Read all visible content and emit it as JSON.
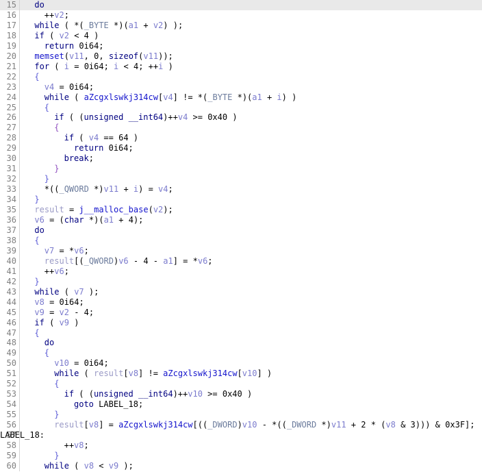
{
  "app": {
    "name": "hex-rays-decompiler-pseudocode",
    "view": "pseudocode",
    "first_line": 15,
    "last_line": 60,
    "highlighted_line": 15,
    "colors": {
      "background": "#ffffff",
      "current_line_highlight": "#e9e9e9",
      "gutter_text": "#808080",
      "gutter_separator": "#d4d4d4",
      "keyword": "#000080",
      "type": "#6b7b9c",
      "local_variable": "#7b7bcd",
      "global_name": "#1414cc",
      "result_variable": "#9a9ac6",
      "punctuation": "#000000",
      "brace_blue": "#5c5cd6",
      "brace_purple": "#8f4fbf"
    }
  },
  "lines": [
    {
      "n": "15",
      "indent": 2,
      "tokens": [
        {
          "t": "do",
          "c": "kw"
        }
      ]
    },
    {
      "n": "16",
      "indent": 4,
      "tokens": [
        {
          "t": "++",
          "c": "pun"
        },
        {
          "t": "v2",
          "c": "loc"
        },
        {
          "t": ";",
          "c": "pun"
        }
      ]
    },
    {
      "n": "17",
      "indent": 2,
      "tokens": [
        {
          "t": "while",
          "c": "kw"
        },
        {
          "t": " ( *(",
          "c": "pun"
        },
        {
          "t": "_BYTE",
          "c": "typ"
        },
        {
          "t": " *)(",
          "c": "pun"
        },
        {
          "t": "a1",
          "c": "loc"
        },
        {
          "t": " + ",
          "c": "pun"
        },
        {
          "t": "v2",
          "c": "loc"
        },
        {
          "t": ") );",
          "c": "pun"
        }
      ]
    },
    {
      "n": "18",
      "indent": 2,
      "tokens": [
        {
          "t": "if",
          "c": "kw"
        },
        {
          "t": " ( ",
          "c": "pun"
        },
        {
          "t": "v2",
          "c": "loc"
        },
        {
          "t": " < ",
          "c": "pun"
        },
        {
          "t": "4",
          "c": "num"
        },
        {
          "t": " )",
          "c": "pun"
        }
      ]
    },
    {
      "n": "19",
      "indent": 4,
      "tokens": [
        {
          "t": "return",
          "c": "kw"
        },
        {
          "t": " ",
          "c": "pun"
        },
        {
          "t": "0i64",
          "c": "num"
        },
        {
          "t": ";",
          "c": "pun"
        }
      ]
    },
    {
      "n": "20",
      "indent": 2,
      "tokens": [
        {
          "t": "memset",
          "c": "glb"
        },
        {
          "t": "(",
          "c": "pun"
        },
        {
          "t": "v11",
          "c": "loc"
        },
        {
          "t": ", ",
          "c": "pun"
        },
        {
          "t": "0",
          "c": "num"
        },
        {
          "t": ", ",
          "c": "pun"
        },
        {
          "t": "sizeof",
          "c": "kw"
        },
        {
          "t": "(",
          "c": "pun"
        },
        {
          "t": "v11",
          "c": "loc"
        },
        {
          "t": "));",
          "c": "pun"
        }
      ]
    },
    {
      "n": "21",
      "indent": 2,
      "tokens": [
        {
          "t": "for",
          "c": "kw"
        },
        {
          "t": " ( ",
          "c": "pun"
        },
        {
          "t": "i",
          "c": "loc"
        },
        {
          "t": " = ",
          "c": "pun"
        },
        {
          "t": "0i64",
          "c": "num"
        },
        {
          "t": "; ",
          "c": "pun"
        },
        {
          "t": "i",
          "c": "loc"
        },
        {
          "t": " < ",
          "c": "pun"
        },
        {
          "t": "4",
          "c": "num"
        },
        {
          "t": "; ++",
          "c": "pun"
        },
        {
          "t": "i",
          "c": "loc"
        },
        {
          "t": " )",
          "c": "pun"
        }
      ]
    },
    {
      "n": "22",
      "indent": 2,
      "tokens": [
        {
          "t": "{",
          "c": "brc"
        }
      ]
    },
    {
      "n": "23",
      "indent": 4,
      "tokens": [
        {
          "t": "v4",
          "c": "loc"
        },
        {
          "t": " = ",
          "c": "pun"
        },
        {
          "t": "0i64",
          "c": "num"
        },
        {
          "t": ";",
          "c": "pun"
        }
      ]
    },
    {
      "n": "24",
      "indent": 4,
      "tokens": [
        {
          "t": "while",
          "c": "kw"
        },
        {
          "t": " ( ",
          "c": "pun"
        },
        {
          "t": "aZcgxlswkj314cw",
          "c": "glb"
        },
        {
          "t": "[",
          "c": "pun"
        },
        {
          "t": "v4",
          "c": "loc"
        },
        {
          "t": "] != *(",
          "c": "pun"
        },
        {
          "t": "_BYTE",
          "c": "typ"
        },
        {
          "t": " *)(",
          "c": "pun"
        },
        {
          "t": "a1",
          "c": "loc"
        },
        {
          "t": " + ",
          "c": "pun"
        },
        {
          "t": "i",
          "c": "loc"
        },
        {
          "t": ") )",
          "c": "pun"
        }
      ]
    },
    {
      "n": "25",
      "indent": 4,
      "tokens": [
        {
          "t": "{",
          "c": "brc"
        }
      ]
    },
    {
      "n": "26",
      "indent": 6,
      "tokens": [
        {
          "t": "if",
          "c": "kw"
        },
        {
          "t": " ( (",
          "c": "pun"
        },
        {
          "t": "unsigned",
          "c": "kw"
        },
        {
          "t": " ",
          "c": "pun"
        },
        {
          "t": "__int64",
          "c": "kw"
        },
        {
          "t": ")++",
          "c": "pun"
        },
        {
          "t": "v4",
          "c": "loc"
        },
        {
          "t": " >= ",
          "c": "pun"
        },
        {
          "t": "0x40",
          "c": "num"
        },
        {
          "t": " )",
          "c": "pun"
        }
      ]
    },
    {
      "n": "27",
      "indent": 6,
      "tokens": [
        {
          "t": "{",
          "c": "brc2"
        }
      ]
    },
    {
      "n": "28",
      "indent": 8,
      "tokens": [
        {
          "t": "if",
          "c": "kw"
        },
        {
          "t": " ( ",
          "c": "pun"
        },
        {
          "t": "v4",
          "c": "loc"
        },
        {
          "t": " == ",
          "c": "pun"
        },
        {
          "t": "64",
          "c": "num"
        },
        {
          "t": " )",
          "c": "pun"
        }
      ]
    },
    {
      "n": "29",
      "indent": 10,
      "tokens": [
        {
          "t": "return",
          "c": "kw"
        },
        {
          "t": " ",
          "c": "pun"
        },
        {
          "t": "0i64",
          "c": "num"
        },
        {
          "t": ";",
          "c": "pun"
        }
      ]
    },
    {
      "n": "30",
      "indent": 8,
      "tokens": [
        {
          "t": "break",
          "c": "kw"
        },
        {
          "t": ";",
          "c": "pun"
        }
      ]
    },
    {
      "n": "31",
      "indent": 6,
      "tokens": [
        {
          "t": "}",
          "c": "brc2"
        }
      ]
    },
    {
      "n": "32",
      "indent": 4,
      "tokens": [
        {
          "t": "}",
          "c": "brc"
        }
      ]
    },
    {
      "n": "33",
      "indent": 4,
      "tokens": [
        {
          "t": "*((",
          "c": "pun"
        },
        {
          "t": "_QWORD",
          "c": "typ"
        },
        {
          "t": " *)",
          "c": "pun"
        },
        {
          "t": "v11",
          "c": "loc"
        },
        {
          "t": " + ",
          "c": "pun"
        },
        {
          "t": "i",
          "c": "loc"
        },
        {
          "t": ") = ",
          "c": "pun"
        },
        {
          "t": "v4",
          "c": "loc"
        },
        {
          "t": ";",
          "c": "pun"
        }
      ]
    },
    {
      "n": "34",
      "indent": 2,
      "tokens": [
        {
          "t": "}",
          "c": "brc"
        }
      ]
    },
    {
      "n": "35",
      "indent": 2,
      "tokens": [
        {
          "t": "result",
          "c": "res"
        },
        {
          "t": " = ",
          "c": "pun"
        },
        {
          "t": "j__malloc_base",
          "c": "glb"
        },
        {
          "t": "(",
          "c": "pun"
        },
        {
          "t": "v2",
          "c": "loc"
        },
        {
          "t": ");",
          "c": "pun"
        }
      ]
    },
    {
      "n": "36",
      "indent": 2,
      "tokens": [
        {
          "t": "v6",
          "c": "loc"
        },
        {
          "t": " = (",
          "c": "pun"
        },
        {
          "t": "char",
          "c": "kw"
        },
        {
          "t": " *)(",
          "c": "pun"
        },
        {
          "t": "a1",
          "c": "loc"
        },
        {
          "t": " + ",
          "c": "pun"
        },
        {
          "t": "4",
          "c": "num"
        },
        {
          "t": ");",
          "c": "pun"
        }
      ]
    },
    {
      "n": "37",
      "indent": 2,
      "tokens": [
        {
          "t": "do",
          "c": "kw"
        }
      ]
    },
    {
      "n": "38",
      "indent": 2,
      "tokens": [
        {
          "t": "{",
          "c": "brc"
        }
      ]
    },
    {
      "n": "39",
      "indent": 4,
      "tokens": [
        {
          "t": "v7",
          "c": "loc"
        },
        {
          "t": " = *",
          "c": "pun"
        },
        {
          "t": "v6",
          "c": "loc"
        },
        {
          "t": ";",
          "c": "pun"
        }
      ]
    },
    {
      "n": "40",
      "indent": 4,
      "tokens": [
        {
          "t": "result",
          "c": "res"
        },
        {
          "t": "[(",
          "c": "pun"
        },
        {
          "t": "_QWORD",
          "c": "typ"
        },
        {
          "t": ")",
          "c": "pun"
        },
        {
          "t": "v6",
          "c": "loc"
        },
        {
          "t": " - ",
          "c": "pun"
        },
        {
          "t": "4",
          "c": "num"
        },
        {
          "t": " - ",
          "c": "pun"
        },
        {
          "t": "a1",
          "c": "loc"
        },
        {
          "t": "] = *",
          "c": "pun"
        },
        {
          "t": "v6",
          "c": "loc"
        },
        {
          "t": ";",
          "c": "pun"
        }
      ]
    },
    {
      "n": "41",
      "indent": 4,
      "tokens": [
        {
          "t": "++",
          "c": "pun"
        },
        {
          "t": "v6",
          "c": "loc"
        },
        {
          "t": ";",
          "c": "pun"
        }
      ]
    },
    {
      "n": "42",
      "indent": 2,
      "tokens": [
        {
          "t": "}",
          "c": "brc"
        }
      ]
    },
    {
      "n": "43",
      "indent": 2,
      "tokens": [
        {
          "t": "while",
          "c": "kw"
        },
        {
          "t": " ( ",
          "c": "pun"
        },
        {
          "t": "v7",
          "c": "loc"
        },
        {
          "t": " );",
          "c": "pun"
        }
      ]
    },
    {
      "n": "44",
      "indent": 2,
      "tokens": [
        {
          "t": "v8",
          "c": "loc"
        },
        {
          "t": " = ",
          "c": "pun"
        },
        {
          "t": "0i64",
          "c": "num"
        },
        {
          "t": ";",
          "c": "pun"
        }
      ]
    },
    {
      "n": "45",
      "indent": 2,
      "tokens": [
        {
          "t": "v9",
          "c": "loc"
        },
        {
          "t": " = ",
          "c": "pun"
        },
        {
          "t": "v2",
          "c": "loc"
        },
        {
          "t": " - ",
          "c": "pun"
        },
        {
          "t": "4",
          "c": "num"
        },
        {
          "t": ";",
          "c": "pun"
        }
      ]
    },
    {
      "n": "46",
      "indent": 2,
      "tokens": [
        {
          "t": "if",
          "c": "kw"
        },
        {
          "t": " ( ",
          "c": "pun"
        },
        {
          "t": "v9",
          "c": "loc"
        },
        {
          "t": " )",
          "c": "pun"
        }
      ]
    },
    {
      "n": "47",
      "indent": 2,
      "tokens": [
        {
          "t": "{",
          "c": "brc"
        }
      ]
    },
    {
      "n": "48",
      "indent": 4,
      "tokens": [
        {
          "t": "do",
          "c": "kw"
        }
      ]
    },
    {
      "n": "49",
      "indent": 4,
      "tokens": [
        {
          "t": "{",
          "c": "brc"
        }
      ]
    },
    {
      "n": "50",
      "indent": 6,
      "tokens": [
        {
          "t": "v10",
          "c": "loc"
        },
        {
          "t": " = ",
          "c": "pun"
        },
        {
          "t": "0i64",
          "c": "num"
        },
        {
          "t": ";",
          "c": "pun"
        }
      ]
    },
    {
      "n": "51",
      "indent": 6,
      "tokens": [
        {
          "t": "while",
          "c": "kw"
        },
        {
          "t": " ( ",
          "c": "pun"
        },
        {
          "t": "result",
          "c": "res"
        },
        {
          "t": "[",
          "c": "pun"
        },
        {
          "t": "v8",
          "c": "loc"
        },
        {
          "t": "] != ",
          "c": "pun"
        },
        {
          "t": "aZcgxlswkj314cw",
          "c": "glb"
        },
        {
          "t": "[",
          "c": "pun"
        },
        {
          "t": "v10",
          "c": "loc"
        },
        {
          "t": "] )",
          "c": "pun"
        }
      ]
    },
    {
      "n": "52",
      "indent": 6,
      "tokens": [
        {
          "t": "{",
          "c": "brc"
        }
      ]
    },
    {
      "n": "53",
      "indent": 8,
      "tokens": [
        {
          "t": "if",
          "c": "kw"
        },
        {
          "t": " ( (",
          "c": "pun"
        },
        {
          "t": "unsigned",
          "c": "kw"
        },
        {
          "t": " ",
          "c": "pun"
        },
        {
          "t": "__int64",
          "c": "kw"
        },
        {
          "t": ")++",
          "c": "pun"
        },
        {
          "t": "v10",
          "c": "loc"
        },
        {
          "t": " >= ",
          "c": "pun"
        },
        {
          "t": "0x40",
          "c": "num"
        },
        {
          "t": " )",
          "c": "pun"
        }
      ]
    },
    {
      "n": "54",
      "indent": 10,
      "tokens": [
        {
          "t": "goto",
          "c": "kw"
        },
        {
          "t": " ",
          "c": "pun"
        },
        {
          "t": "LABEL_18",
          "c": "lbl"
        },
        {
          "t": ";",
          "c": "pun"
        }
      ]
    },
    {
      "n": "55",
      "indent": 6,
      "tokens": [
        {
          "t": "}",
          "c": "brc"
        }
      ]
    },
    {
      "n": "56",
      "indent": 6,
      "tokens": [
        {
          "t": "result",
          "c": "res"
        },
        {
          "t": "[",
          "c": "pun"
        },
        {
          "t": "v8",
          "c": "loc"
        },
        {
          "t": "] = ",
          "c": "pun"
        },
        {
          "t": "aZcgxlswkj314cw",
          "c": "glb"
        },
        {
          "t": "[((",
          "c": "pun"
        },
        {
          "t": "_DWORD",
          "c": "typ"
        },
        {
          "t": ")",
          "c": "pun"
        },
        {
          "t": "v10",
          "c": "loc"
        },
        {
          "t": " - *((",
          "c": "pun"
        },
        {
          "t": "_DWORD",
          "c": "typ"
        },
        {
          "t": " *)",
          "c": "pun"
        },
        {
          "t": "v11",
          "c": "loc"
        },
        {
          "t": " + ",
          "c": "pun"
        },
        {
          "t": "2",
          "c": "num"
        },
        {
          "t": " * (",
          "c": "pun"
        },
        {
          "t": "v8",
          "c": "loc"
        },
        {
          "t": " & ",
          "c": "pun"
        },
        {
          "t": "3",
          "c": "num"
        },
        {
          "t": "))) & ",
          "c": "pun"
        },
        {
          "t": "0x3F",
          "c": "num"
        },
        {
          "t": "];",
          "c": "pun"
        }
      ]
    },
    {
      "n": "57",
      "indent": 0,
      "gutterless": true,
      "tokens": [
        {
          "t": "LABEL_18",
          "c": "lbl"
        },
        {
          "t": ":",
          "c": "pun"
        }
      ]
    },
    {
      "n": "58",
      "indent": 8,
      "tokens": [
        {
          "t": "++",
          "c": "pun"
        },
        {
          "t": "v8",
          "c": "loc"
        },
        {
          "t": ";",
          "c": "pun"
        }
      ]
    },
    {
      "n": "59",
      "indent": 6,
      "tokens": [
        {
          "t": "}",
          "c": "brc"
        }
      ]
    },
    {
      "n": "60",
      "indent": 4,
      "tokens": [
        {
          "t": "while",
          "c": "kw"
        },
        {
          "t": " ( ",
          "c": "pun"
        },
        {
          "t": "v8",
          "c": "loc"
        },
        {
          "t": " < ",
          "c": "pun"
        },
        {
          "t": "v9",
          "c": "loc"
        },
        {
          "t": " );",
          "c": "pun"
        }
      ]
    }
  ]
}
